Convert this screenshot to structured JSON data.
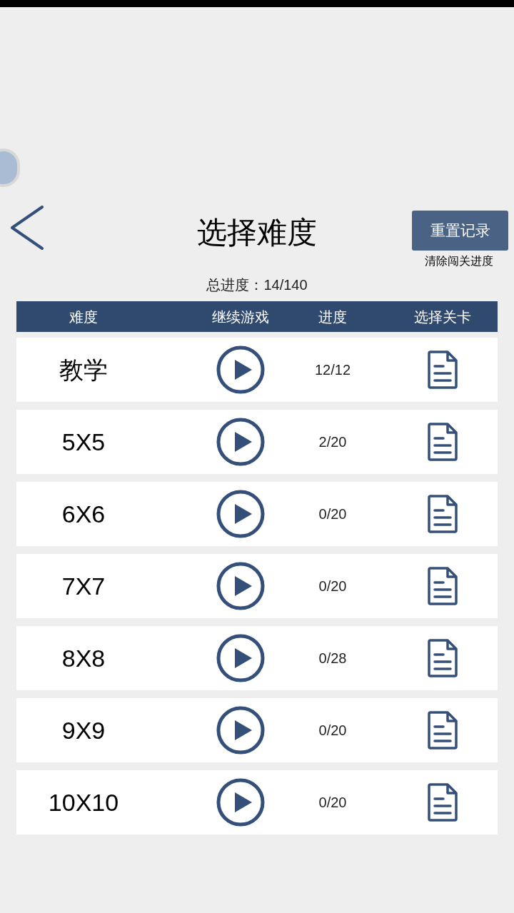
{
  "header": {
    "title": "选择难度",
    "reset_button": "重置记录",
    "reset_hint": "清除闯关进度"
  },
  "total_progress": "总进度：14/140",
  "table": {
    "columns": [
      "难度",
      "继续游戏",
      "进度",
      "选择关卡"
    ],
    "rows": [
      {
        "name": "教学",
        "progress": "12/12"
      },
      {
        "name": "5X5",
        "progress": "2/20"
      },
      {
        "name": "6X6",
        "progress": "0/20"
      },
      {
        "name": "7X7",
        "progress": "0/20"
      },
      {
        "name": "8X8",
        "progress": "0/28"
      },
      {
        "name": "9X9",
        "progress": "0/20"
      },
      {
        "name": "10X10",
        "progress": "0/20"
      }
    ]
  }
}
